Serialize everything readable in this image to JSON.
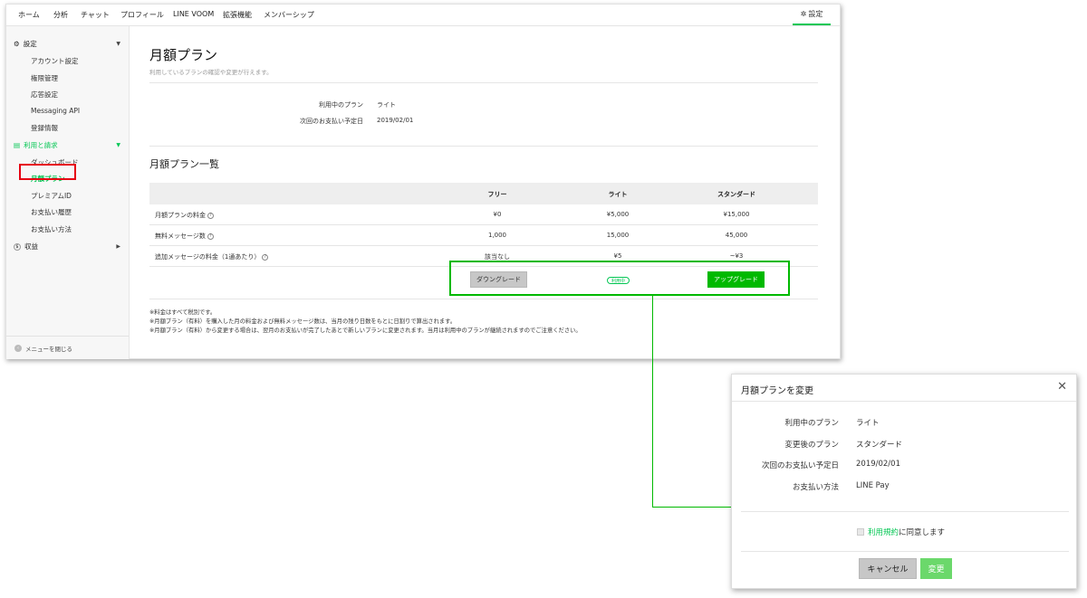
{
  "topnav": {
    "items": [
      "ホーム",
      "分析",
      "チャット",
      "プロフィール",
      "LINE VOOM",
      "拡張機能",
      "メンバーシップ"
    ],
    "settings_label": "設定"
  },
  "sidebar": {
    "settings_section": "設定",
    "settings_items": [
      "アカウント設定",
      "権限管理",
      "応答設定",
      "Messaging API",
      "登録情報"
    ],
    "billing_section": "利用と請求",
    "billing_items": [
      "ダッシュボード",
      "月額プラン",
      "プレミアムID",
      "お支払い履歴",
      "お支払い方法"
    ],
    "revenue_section": "収益",
    "close_menu": "メニューを閉じる"
  },
  "page": {
    "title": "月額プラン",
    "subtitle": "利用しているプランの確認や変更が行えます。",
    "current_plan_label": "利用中のプラン",
    "current_plan_value": "ライト",
    "next_payment_label": "次回のお支払い予定日",
    "next_payment_value": "2019/02/01",
    "list_title": "月額プラン一覧"
  },
  "plan_table": {
    "headers": [
      "フリー",
      "ライト",
      "スタンダード"
    ],
    "rows": [
      {
        "label": "月額プランの料金",
        "values": [
          "¥0",
          "¥5,000",
          "¥15,000"
        ]
      },
      {
        "label": "無料メッセージ数",
        "values": [
          "1,000",
          "15,000",
          "45,000"
        ]
      },
      {
        "label": "追加メッセージの料金（1通あたり）",
        "values": [
          "該当なし",
          "¥5",
          "~¥3"
        ]
      }
    ],
    "downgrade_label": "ダウングレード",
    "in_use_label": "利用中",
    "upgrade_label": "アップグレード"
  },
  "notes": [
    "※料金はすべて税別です。",
    "※月額プラン（有料）を購入した月の料金および無料メッセージ数は、当月の残り日数をもとに日割りで算出されます。",
    "※月額プラン（有料）から変更する場合は、翌月のお支払いが完了したあとで新しいプランに変更されます。当月は利用中のプランが継続されますのでご注意ください。"
  ],
  "modal": {
    "title": "月額プランを変更",
    "current_plan_label": "利用中のプラン",
    "current_plan_value": "ライト",
    "new_plan_label": "変更後のプラン",
    "new_plan_value": "スタンダード",
    "next_payment_label": "次回のお支払い予定日",
    "next_payment_value": "2019/02/01",
    "payment_method_label": "お支払い方法",
    "payment_method_value": "LINE Pay",
    "terms_link": "利用規約",
    "terms_suffix": "に同意します",
    "cancel_label": "キャンセル",
    "change_label": "変更"
  },
  "colors": {
    "accent": "#06c755",
    "highlight_green": "#00b900",
    "highlight_red": "#e60012"
  }
}
